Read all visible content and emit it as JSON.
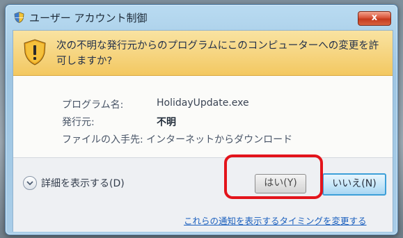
{
  "window": {
    "title": "ユーザー アカウント制御",
    "close_label": "x"
  },
  "banner": {
    "message": "次の不明な発行元からのプログラムにこのコンピューターへの変更を許可しますか?",
    "icon": "warning-shield-icon"
  },
  "details": {
    "program_label": "プログラム名:",
    "program_value": "HolidayUpdate.exe",
    "publisher_label": "発行元:",
    "publisher_value": "不明",
    "origin_text": "ファイルの入手先: インターネットからダウンロード"
  },
  "footer": {
    "show_details": "詳細を表示する(D)",
    "yes_button": "はい(Y)",
    "no_button": "いいえ(N)",
    "notify_link": "これらの通知を表示するタイミングを変更する"
  },
  "colors": {
    "highlight": "#e3141b",
    "banner": "#f3c861",
    "link": "#1a5fbe"
  }
}
